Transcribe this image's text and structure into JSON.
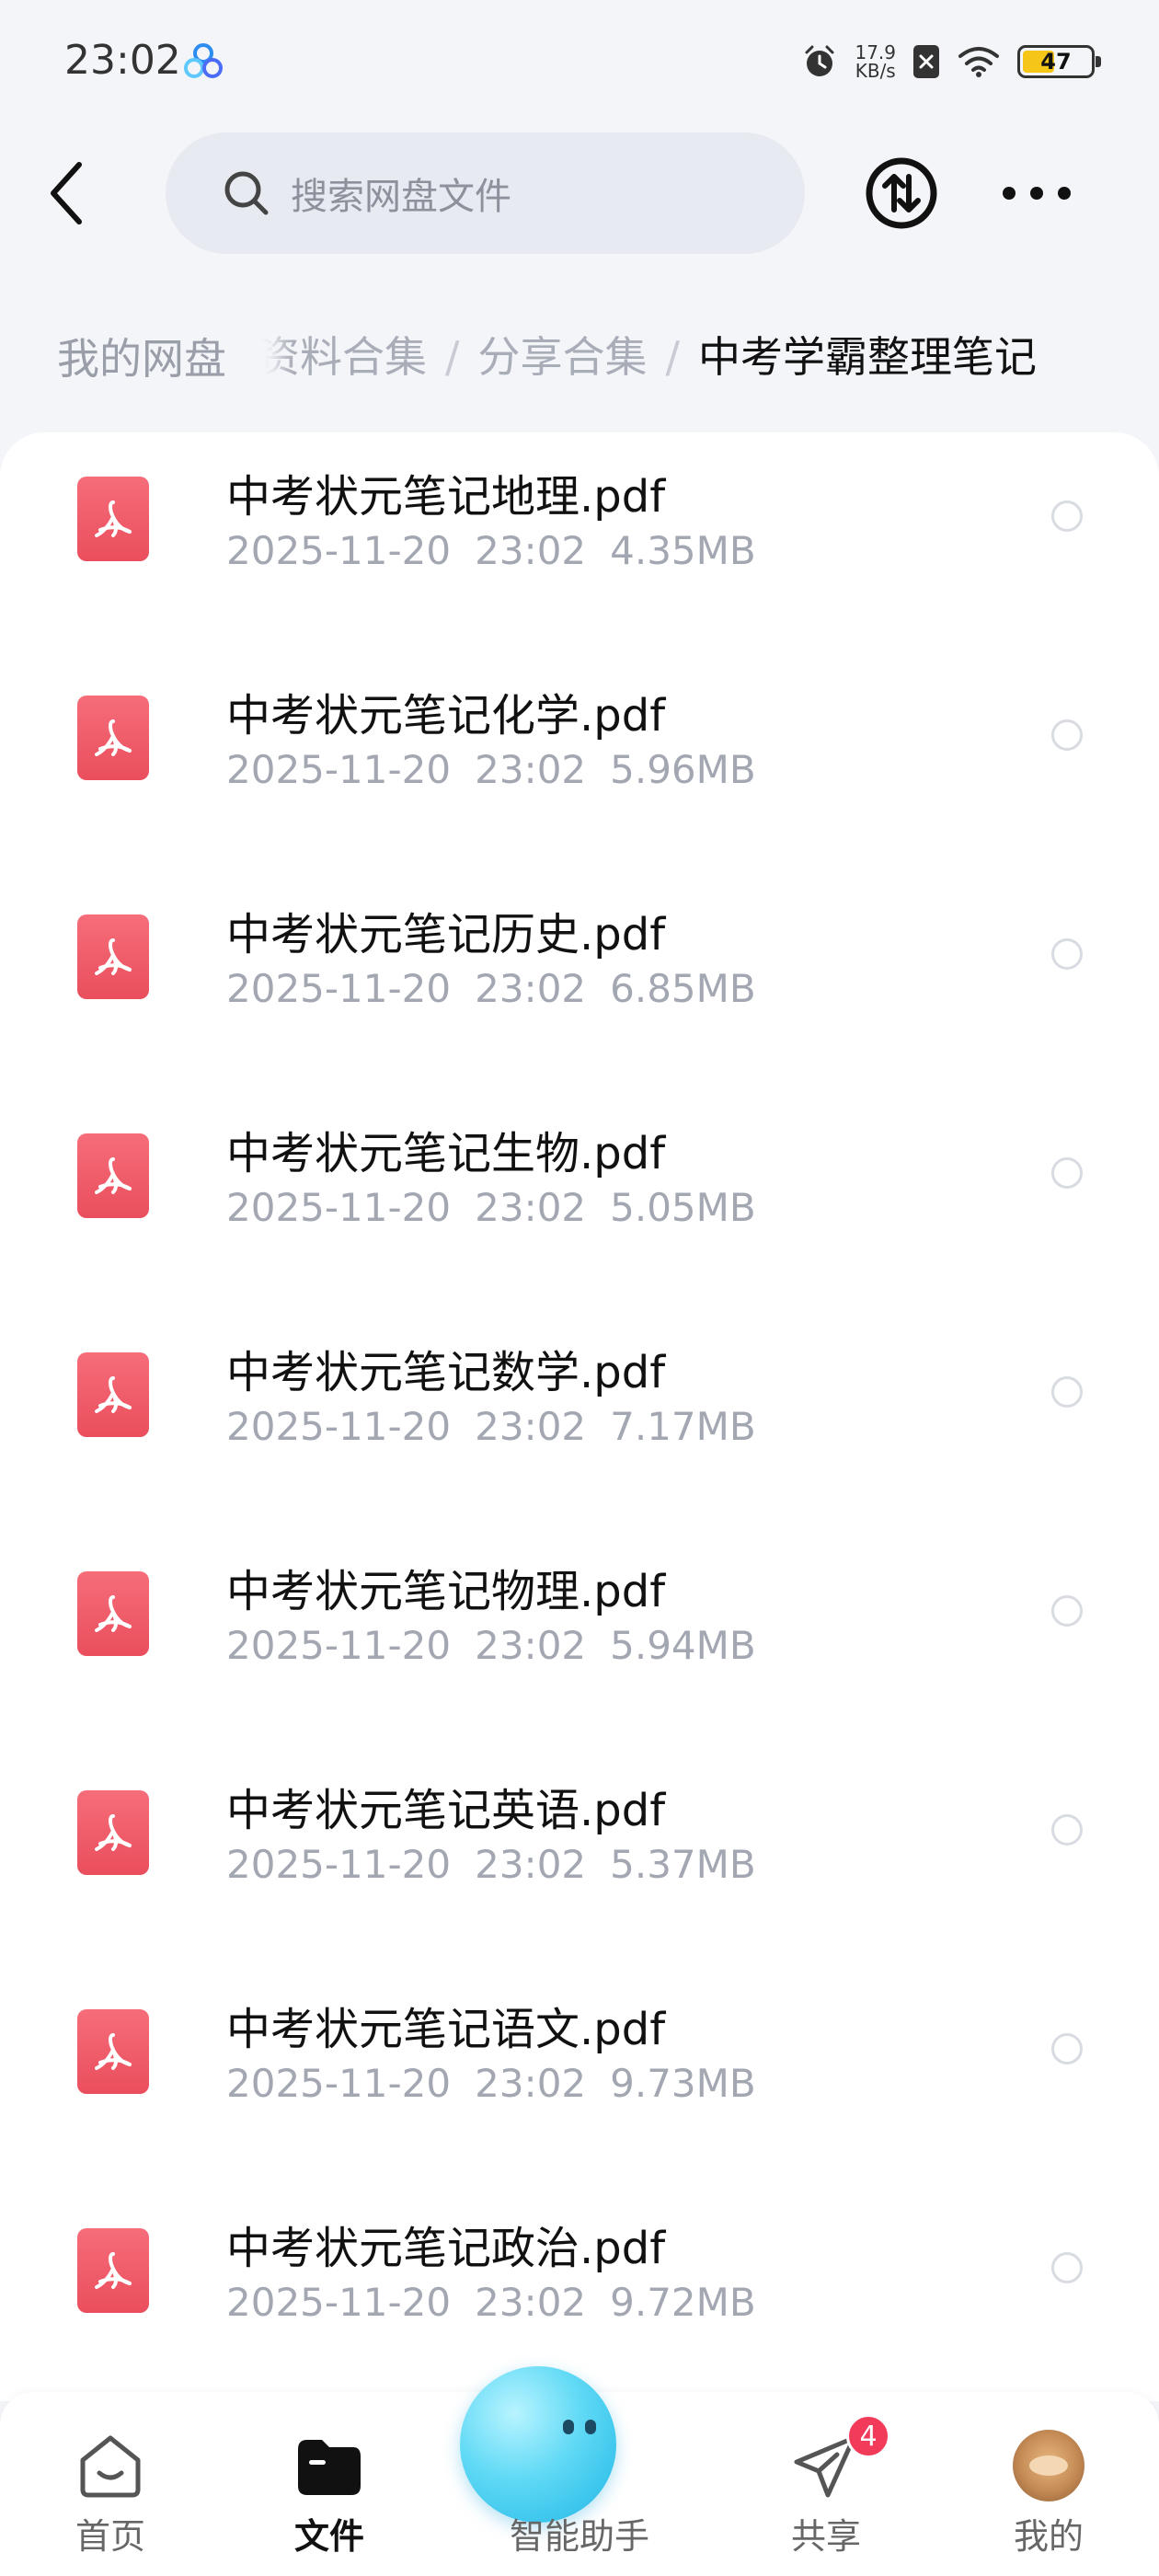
{
  "status_bar": {
    "time": "23:02",
    "net_speed_value": "17.9",
    "net_speed_unit": "KB/s",
    "battery": "47",
    "battery_level": 0.47,
    "icons": [
      "app-cloud-icon",
      "alarm-icon",
      "sim-off-icon",
      "wifi-icon",
      "battery-icon"
    ]
  },
  "header": {
    "search_placeholder": "搜索网盘文件",
    "icons": [
      "back-arrow-icon",
      "search-icon",
      "transfer-icon",
      "more-icon"
    ]
  },
  "breadcrumb": {
    "root": "我的网盘",
    "items": [
      "资料合集",
      "分享合集"
    ],
    "current": "中考学霸整理笔记",
    "separator": "/"
  },
  "files": [
    {
      "name": "中考状元笔记地理.pdf",
      "date": "2025-11-20",
      "time": "23:02",
      "size": "4.35MB"
    },
    {
      "name": "中考状元笔记化学.pdf",
      "date": "2025-11-20",
      "time": "23:02",
      "size": "5.96MB"
    },
    {
      "name": "中考状元笔记历史.pdf",
      "date": "2025-11-20",
      "time": "23:02",
      "size": "6.85MB"
    },
    {
      "name": "中考状元笔记生物.pdf",
      "date": "2025-11-20",
      "time": "23:02",
      "size": "5.05MB"
    },
    {
      "name": "中考状元笔记数学.pdf",
      "date": "2025-11-20",
      "time": "23:02",
      "size": "7.17MB"
    },
    {
      "name": "中考状元笔记物理.pdf",
      "date": "2025-11-20",
      "time": "23:02",
      "size": "5.94MB"
    },
    {
      "name": "中考状元笔记英语.pdf",
      "date": "2025-11-20",
      "time": "23:02",
      "size": "5.37MB"
    },
    {
      "name": "中考状元笔记语文.pdf",
      "date": "2025-11-20",
      "time": "23:02",
      "size": "9.73MB"
    },
    {
      "name": "中考状元笔记政治.pdf",
      "date": "2025-11-20",
      "time": "23:02",
      "size": "9.72MB"
    }
  ],
  "bottom_nav": {
    "items": [
      {
        "label": "首页",
        "icon": "home-icon",
        "active": false
      },
      {
        "label": "文件",
        "icon": "folder-icon",
        "active": true
      },
      {
        "label": "智能助手",
        "icon": "assistant-icon",
        "active": false
      },
      {
        "label": "共享",
        "icon": "share-icon",
        "active": false,
        "badge": "4"
      },
      {
        "label": "我的",
        "icon": "avatar",
        "active": false
      }
    ]
  },
  "colors": {
    "background": "#f4f5f9",
    "pdf_icon": "#ef5a67",
    "muted_text": "#a3a7b2",
    "badge": "#f23a5a",
    "battery_fill": "#f5c518"
  }
}
